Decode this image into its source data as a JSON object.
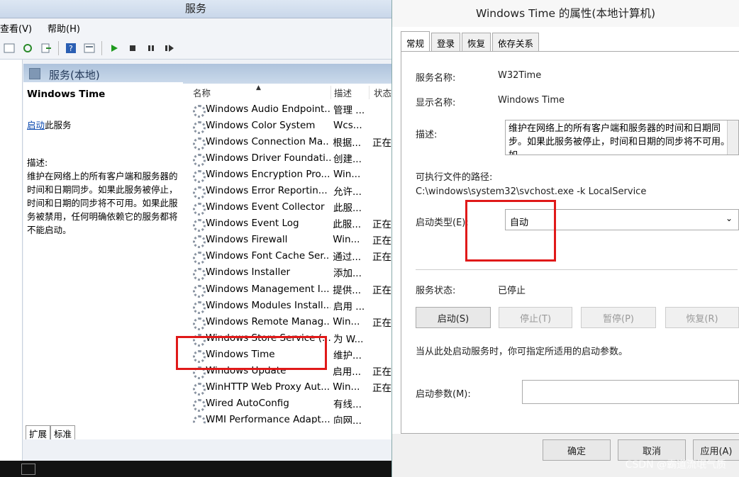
{
  "services_window": {
    "title": "服务",
    "menu": [
      "查看(V)",
      "帮助(H)"
    ],
    "panel_title": "服务(本地)",
    "tabs_bottom": [
      "扩展",
      "标准"
    ]
  },
  "extended_view": {
    "service_name": "Windows Time",
    "start_link": "启动",
    "start_suffix": "此服务",
    "description_label": "描述:",
    "description": "维护在网络上的所有客户端和服务器的时间和日期同步。如果此服务被停止，时间和日期的同步将不可用。如果此服务被禁用，任何明确依赖它的服务都将不能启动。"
  },
  "list": {
    "columns": [
      "名称",
      "描述",
      "状态"
    ],
    "rows": [
      {
        "name": "Windows Audio Endpoint...",
        "desc": "管理 ...",
        "status": ""
      },
      {
        "name": "Windows Color System",
        "desc": "Wcs...",
        "status": ""
      },
      {
        "name": "Windows Connection Ma...",
        "desc": "根据...",
        "status": "正在"
      },
      {
        "name": "Windows Driver Foundati...",
        "desc": "创建...",
        "status": ""
      },
      {
        "name": "Windows Encryption Pro...",
        "desc": "Win...",
        "status": ""
      },
      {
        "name": "Windows Error Reportin...",
        "desc": "允许...",
        "status": ""
      },
      {
        "name": "Windows Event Collector",
        "desc": "此服...",
        "status": ""
      },
      {
        "name": "Windows Event Log",
        "desc": "此服...",
        "status": "正在"
      },
      {
        "name": "Windows Firewall",
        "desc": "Win...",
        "status": "正在"
      },
      {
        "name": "Windows Font Cache Ser...",
        "desc": "通过...",
        "status": "正在"
      },
      {
        "name": "Windows Installer",
        "desc": "添加...",
        "status": ""
      },
      {
        "name": "Windows Management I...",
        "desc": "提供...",
        "status": "正在"
      },
      {
        "name": "Windows Modules Install...",
        "desc": "启用 ...",
        "status": ""
      },
      {
        "name": "Windows Remote Manag...",
        "desc": "Win...",
        "status": "正在"
      },
      {
        "name": "Windows Store Service (...",
        "desc": "为 W...",
        "status": ""
      },
      {
        "name": "Windows Time",
        "desc": "维护...",
        "status": ""
      },
      {
        "name": "Windows Update",
        "desc": "启用...",
        "status": "正在"
      },
      {
        "name": "WinHTTP Web Proxy Aut...",
        "desc": "Win...",
        "status": "正在"
      },
      {
        "name": "Wired AutoConfig",
        "desc": "有线...",
        "status": ""
      },
      {
        "name": "WMI Performance Adapt...",
        "desc": "向网...",
        "status": ""
      }
    ]
  },
  "dialog": {
    "title": "Windows Time 的属性(本地计算机)",
    "tabs": [
      "常规",
      "登录",
      "恢复",
      "依存关系"
    ],
    "service_name_label": "服务名称:",
    "service_name": "W32Time",
    "display_name_label": "显示名称:",
    "display_name": "Windows Time",
    "description_label": "描述:",
    "description": "维护在网络上的所有客户端和服务器的时间和日期同步。如果此服务被停止，时间和日期的同步将不可用。如",
    "path_label": "可执行文件的路径:",
    "path": "C:\\windows\\system32\\svchost.exe -k LocalService",
    "startup_type_label": "启动类型(E):",
    "startup_type": "自动",
    "status_label": "服务状态:",
    "status": "已停止",
    "buttons": {
      "start": "启动(S)",
      "stop": "停止(T)",
      "pause": "暂停(P)",
      "resume": "恢复(R)"
    },
    "hint": "当从此处启动服务时，你可指定所适用的启动参数。",
    "params_label": "启动参数(M):",
    "ok": "确定",
    "cancel": "取消",
    "apply": "应用(A)"
  },
  "watermark": "CSDN @霸道流氓气质"
}
